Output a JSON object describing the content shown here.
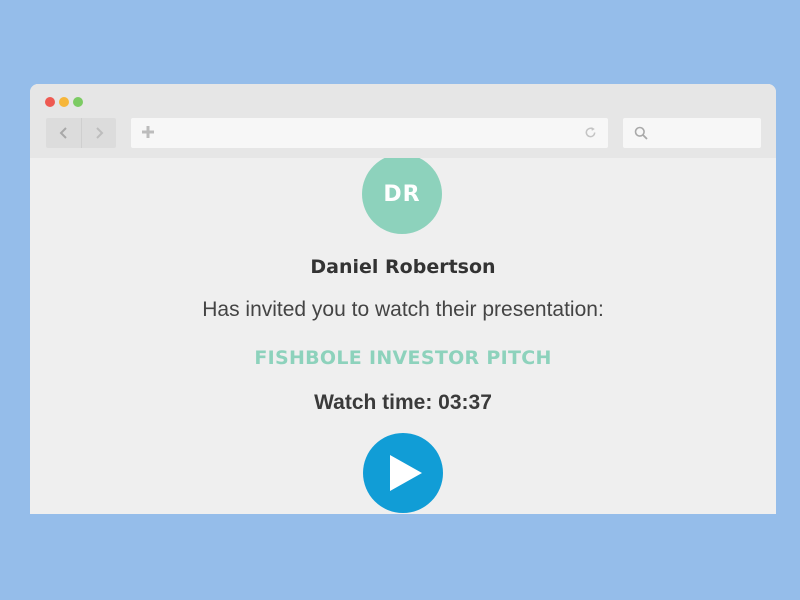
{
  "browser": {
    "window_controls": [
      "close",
      "minimize",
      "maximize"
    ],
    "nav": {
      "back_icon": "chevron-left-icon",
      "forward_icon": "chevron-right-icon"
    },
    "address_bar": {
      "value": "",
      "left_icon": "plus-icon",
      "right_icon": "refresh-icon"
    },
    "search": {
      "value": "",
      "icon": "search-icon"
    }
  },
  "invite": {
    "avatar_initials": "DR",
    "sender_name": "Daniel Robertson",
    "message": "Has invited you to watch their presentation:",
    "presentation_title": "FISHBOLE INVESTOR PITCH",
    "watch_time": "Watch time: 03:37",
    "play_icon": "play-icon"
  },
  "colors": {
    "page_background": "#95bdea",
    "accent_teal": "#8dd2bc",
    "play_blue": "#119dd6"
  }
}
